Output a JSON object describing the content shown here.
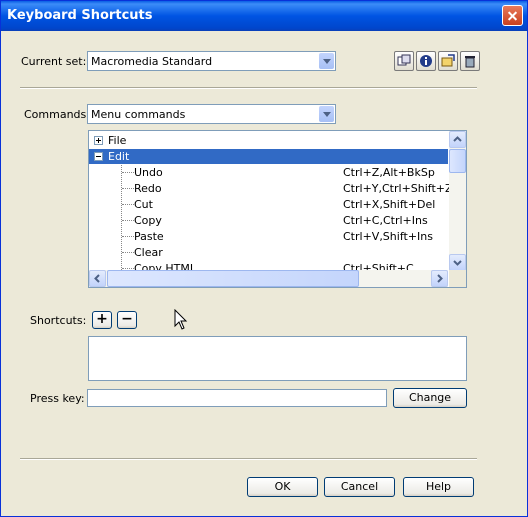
{
  "window": {
    "title": "Keyboard Shortcuts"
  },
  "current_set": {
    "label": "Current set:",
    "value": "Macromedia Standard"
  },
  "set_toolbar": {
    "icons": [
      "duplicate-set-icon",
      "info-icon",
      "export-html-icon",
      "delete-set-icon"
    ]
  },
  "commands": {
    "label": "Commands:",
    "value": "Menu commands"
  },
  "tree": {
    "rows": [
      {
        "name": "File",
        "keys": "",
        "expander": "plus"
      },
      {
        "name": "Edit",
        "keys": "",
        "expander": "minus",
        "selected": true
      },
      {
        "name": "Undo",
        "keys": "Ctrl+Z,Alt+BkSp"
      },
      {
        "name": "Redo",
        "keys": "Ctrl+Y,Ctrl+Shift+Z"
      },
      {
        "name": "Cut",
        "keys": "Ctrl+X,Shift+Del"
      },
      {
        "name": "Copy",
        "keys": "Ctrl+C,Ctrl+Ins"
      },
      {
        "name": "Paste",
        "keys": "Ctrl+V,Shift+Ins"
      },
      {
        "name": "Clear",
        "keys": ""
      },
      {
        "name": "Copy HTML",
        "keys": "Ctrl+Shift+C"
      }
    ]
  },
  "shortcuts": {
    "label": "Shortcuts:",
    "add": "+",
    "remove": "−"
  },
  "press_key": {
    "label": "Press key:",
    "value": "",
    "change": "Change"
  },
  "footer": {
    "ok": "OK",
    "cancel": "Cancel",
    "help": "Help"
  }
}
